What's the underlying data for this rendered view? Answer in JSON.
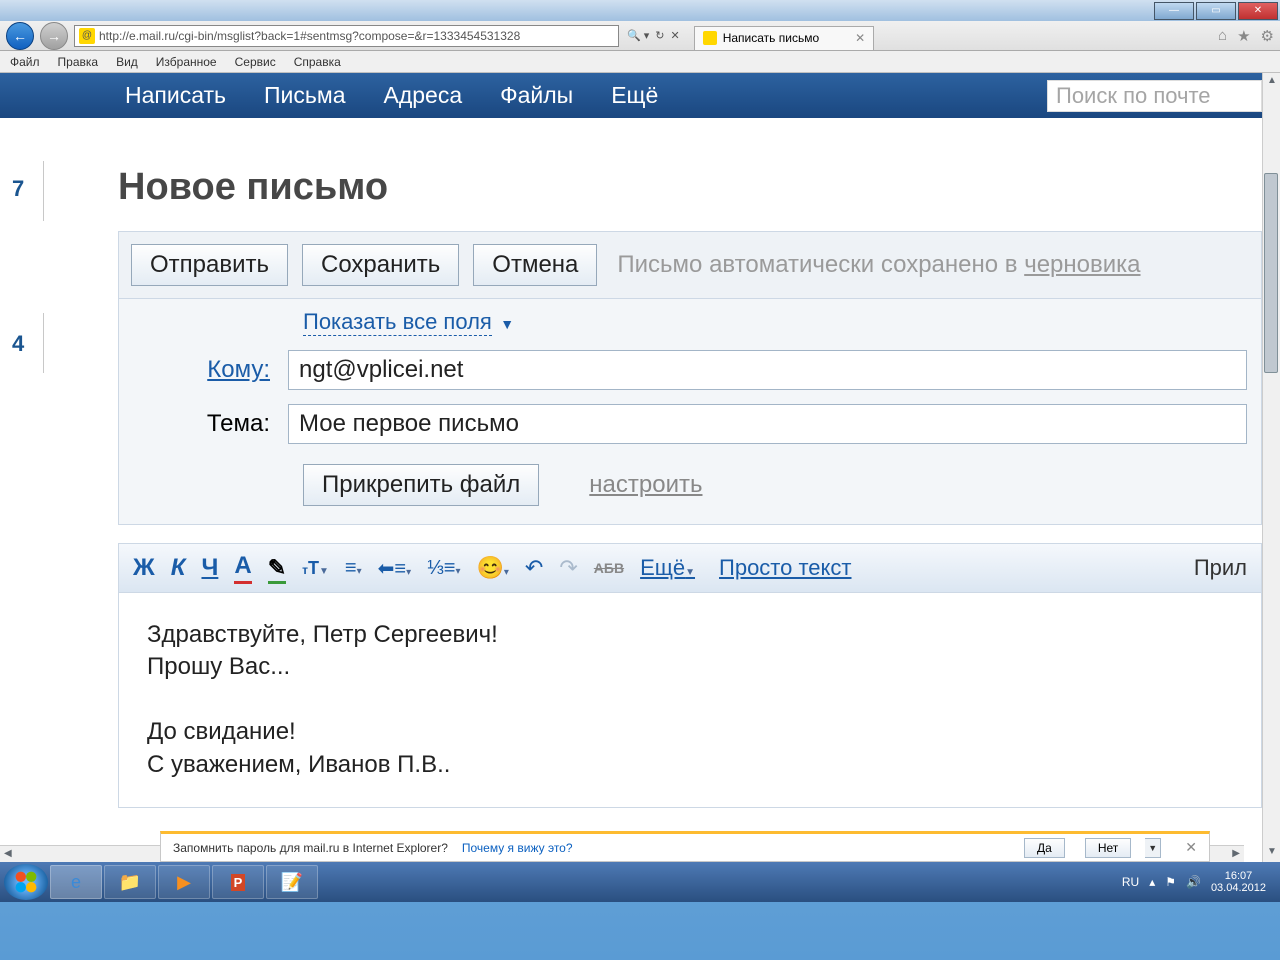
{
  "window": {
    "url": "http://e.mail.ru/cgi-bin/msglist?back=1#sentmsg?compose=&r=1333454531328",
    "tab_title": "Написать письмо"
  },
  "ie_menu": {
    "file": "Файл",
    "edit": "Правка",
    "view": "Вид",
    "favorites": "Избранное",
    "tools": "Сервис",
    "help": "Справка"
  },
  "mail_nav": {
    "compose": "Написать",
    "letters": "Письма",
    "addresses": "Адреса",
    "files": "Файлы",
    "more": "Ещё",
    "search_placeholder": "Поиск по почте"
  },
  "gutter": {
    "n1": "7",
    "n2": "4"
  },
  "compose": {
    "title": "Новое письмо",
    "send": "Отправить",
    "save": "Сохранить",
    "cancel": "Отмена",
    "autosave_text": "Письмо автоматически сохранено в ",
    "draft_link": "черновика",
    "show_all": "Показать все поля",
    "to_label": "Кому:",
    "to_value": "ngt@vplicei.net",
    "subject_label": "Тема:",
    "subject_value": "Мое первое письмо",
    "attach": "Прикрепить файл",
    "configure": "настроить"
  },
  "toolbar": {
    "bold": "Ж",
    "italic": "К",
    "underline": "Ч",
    "color": "А",
    "highlight": "✎",
    "strike": "АБВ",
    "more": "Ещё",
    "plain": "Просто текст",
    "attachments": "Прил"
  },
  "body_text": "Здравствуйте, Петр Сергеевич!\nПрошу Вас...\n\nДо свидание!\nС уважением, Иванов П.В..",
  "infobar": {
    "text": "Запомнить пароль для mail.ru в Internet Explorer?",
    "why": "Почему я вижу это?",
    "yes": "Да",
    "no": "Нет"
  },
  "tray": {
    "lang": "RU",
    "time": "16:07",
    "date": "03.04.2012"
  }
}
